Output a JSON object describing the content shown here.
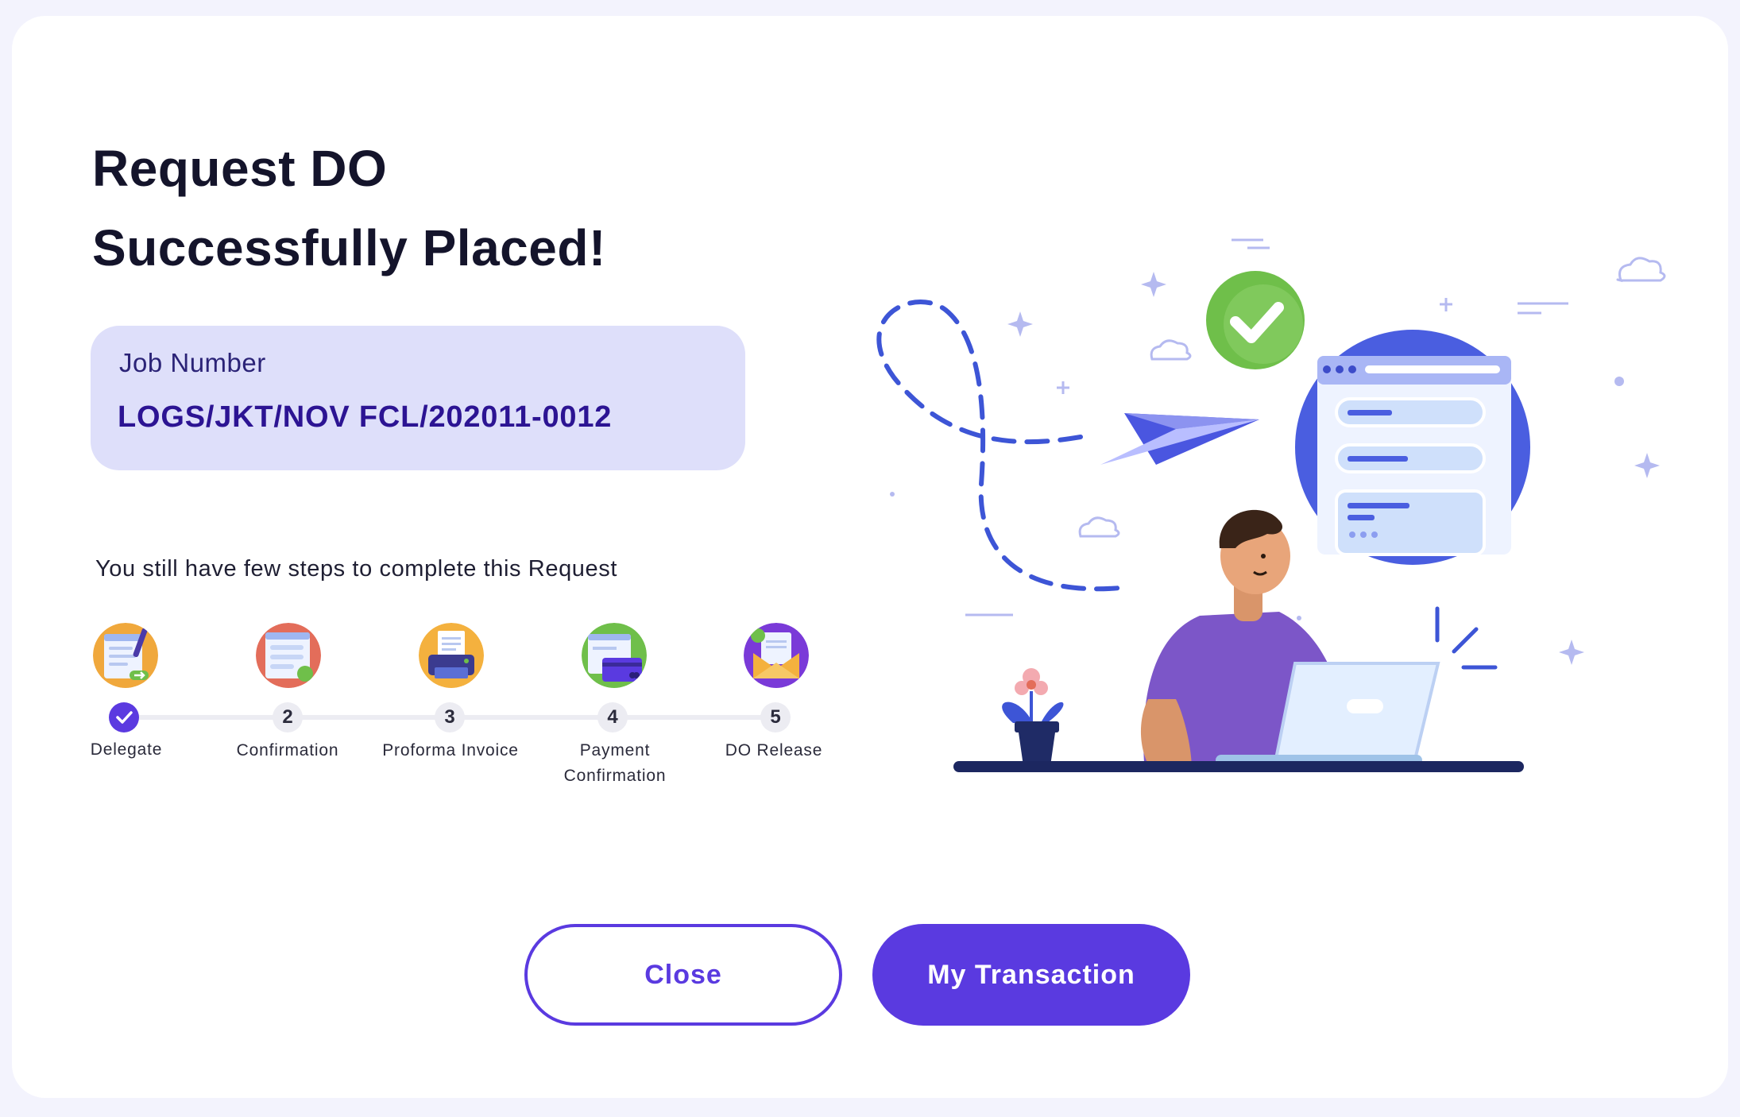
{
  "dialog": {
    "title_line1": "Request DO",
    "title_line2": "Successfully Placed!"
  },
  "job": {
    "label": "Job Number",
    "value": "LOGS/JKT/NOV FCL/202011-0012"
  },
  "steps_hint": "You still have few steps to complete this Request",
  "steps": [
    {
      "number": "",
      "label": "Delegate",
      "status": "done",
      "icon": "delegate-document-icon"
    },
    {
      "number": "2",
      "label": "Confirmation",
      "status": "pending",
      "icon": "confirmation-document-icon"
    },
    {
      "number": "3",
      "label": "Proforma Invoice",
      "status": "pending",
      "icon": "printer-invoice-icon"
    },
    {
      "number": "4",
      "label": "Payment Confirmation",
      "status": "pending",
      "icon": "credit-card-icon"
    },
    {
      "number": "5",
      "label": "DO Release",
      "status": "pending",
      "icon": "envelope-release-icon"
    }
  ],
  "buttons": {
    "close": "Close",
    "primary": "My Transaction"
  },
  "colors": {
    "accent": "#5a3ae0",
    "job_box_bg": "#dedffa",
    "job_value": "#2c1493",
    "success_green": "#6fbf4a"
  }
}
